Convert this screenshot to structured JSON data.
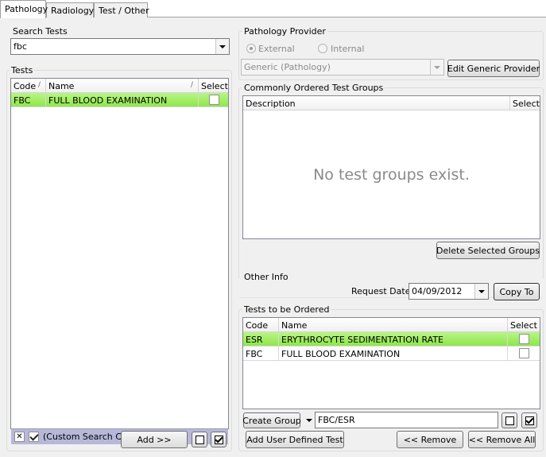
{
  "tabs": [
    {
      "label": "Pathology",
      "active": true
    },
    {
      "label": "Radiology",
      "active": false
    },
    {
      "label": "Test / Other",
      "active": false
    }
  ],
  "search": {
    "label": "Search Tests",
    "value": "fbc"
  },
  "tests": {
    "label": "Tests",
    "columns": {
      "code": "Code",
      "name": "Name",
      "select": "Select"
    },
    "rows": [
      {
        "code": "FBC",
        "name": "FULL BLOOD EXAMINATION",
        "selected": false
      }
    ],
    "filter_text": "(Custom Search Criteria)",
    "filter_checked": true,
    "add_label": "Add >>"
  },
  "provider": {
    "label": "Pathology Provider",
    "external_label": "External",
    "internal_label": "Internal",
    "selected": "External",
    "combo_value": "Generic (Pathology)",
    "edit_label": "Edit Generic Provider"
  },
  "groups": {
    "label": "Commonly Ordered Test Groups",
    "columns": {
      "description": "Description",
      "select": "Select"
    },
    "empty_text": "No test groups exist.",
    "delete_label": "Delete Selected Groups"
  },
  "other_info": {
    "label": "Other Info",
    "request_date_label": "Request Date",
    "request_date": "04/09/2012",
    "copy_label": "Copy To"
  },
  "ordered": {
    "label": "Tests to be Ordered",
    "columns": {
      "code": "Code",
      "name": "Name",
      "select": "Select"
    },
    "rows": [
      {
        "code": "ESR",
        "name": "ERYTHROCYTE SEDIMENTATION RATE",
        "selected": false
      },
      {
        "code": "FBC",
        "name": "FULL BLOOD EXAMINATION",
        "selected": false
      }
    ],
    "create_group_label": "Create Group",
    "group_value": "FBC/ESR",
    "add_user_label": "Add User Defined Test",
    "remove_label": "<< Remove",
    "remove_all_label": "<< Remove All"
  },
  "colors": {
    "selected_row": "#a8f06a",
    "filter_bar": "#b7b8d8"
  }
}
